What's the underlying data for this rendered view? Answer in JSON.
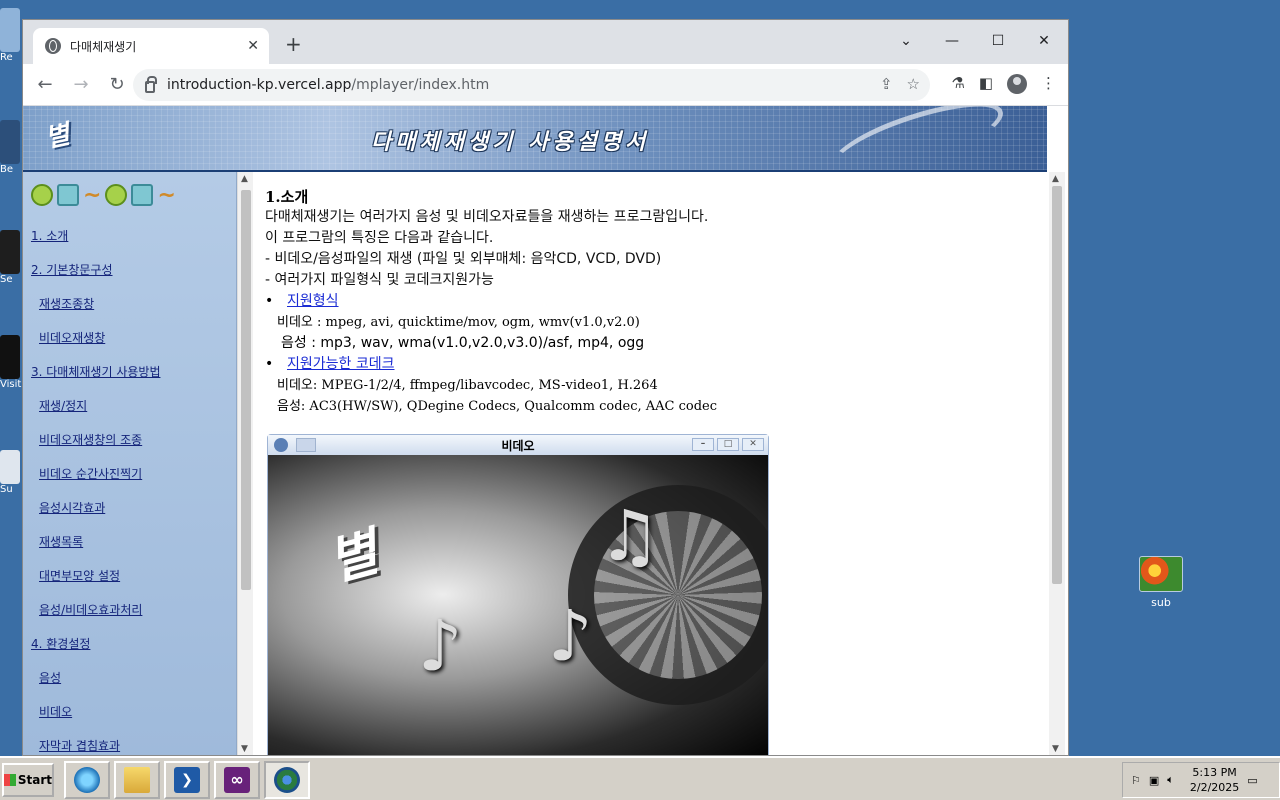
{
  "desktop": {
    "left_icons": [
      "Re",
      "Be",
      "Se",
      "Visit",
      "Su"
    ],
    "right_icon": {
      "label": "sub"
    }
  },
  "browser": {
    "tab_title": "다매체재생기",
    "url_host": "introduction-kp.vercel.app",
    "url_path": "/mplayer/index.htm"
  },
  "page": {
    "banner_logo": "별",
    "banner_title": "다매체재생기 사용설명서",
    "menu": [
      {
        "label": "1. 소개",
        "sub": false
      },
      {
        "label": "2. 기본창문구성",
        "sub": false
      },
      {
        "label": "재생조종창",
        "sub": true
      },
      {
        "label": "비데오재생창",
        "sub": true
      },
      {
        "label": "3. 다매체재생기 사용방법",
        "sub": false
      },
      {
        "label": "재생/정지",
        "sub": true
      },
      {
        "label": "비데오재생창의 조종",
        "sub": true
      },
      {
        "label": "비데오 순간사진찍기",
        "sub": true
      },
      {
        "label": "음성시각효과",
        "sub": true
      },
      {
        "label": "재생목록",
        "sub": true
      },
      {
        "label": "대면부모양 설정",
        "sub": true
      },
      {
        "label": "음성/비데오효과처리",
        "sub": true
      },
      {
        "label": "4. 환경설정",
        "sub": false
      },
      {
        "label": "음성",
        "sub": true
      },
      {
        "label": "비데오",
        "sub": true
      },
      {
        "label": "자막과 겹침효과",
        "sub": true
      }
    ],
    "content": {
      "heading": "1.소개",
      "intro1": "다매체재생기는 여러가지 음성 및 비데오자료들을 재생하는 프로그람입니다.",
      "intro2": "이 프로그람의 특징은 다음과 같습니다.",
      "feature1": "- 비데오/음성파일의 재생 (파일 및 외부매체: 음악CD, VCD, DVD)",
      "feature2": "- 여러가지 파일형식 및 코데크지원가능",
      "formats_link": "지원형식",
      "formats_video": "비데오 : mpeg, avi, quicktime/mov, ogm, wmv(v1.0,v2.0)",
      "formats_audio": "음성 : mp3, wav, wma(v1.0,v2.0,v3.0)/asf, mp4, ogg",
      "codecs_link": "지원가능한 코데크",
      "codecs_video": "비데오: MPEG-1/2/4, ffmpeg/libavcodec,  MS-video1, H.264",
      "codecs_audio": "음성: AC3(HW/SW), QDegine Codecs, Qualcomm codec, AAC codec",
      "video_window_title": "비데오",
      "video_logo": "별"
    }
  },
  "taskbar": {
    "start_label": "Start",
    "time": "5:13 PM",
    "date": "2/2/2025"
  }
}
